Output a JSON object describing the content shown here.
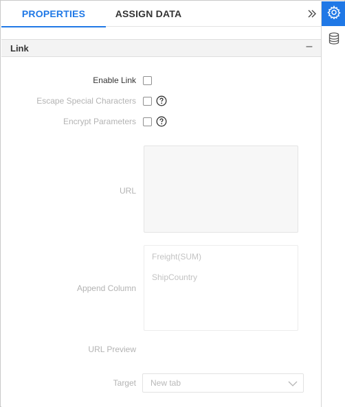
{
  "tabs": {
    "properties": "PROPERTIES",
    "assign_data": "ASSIGN DATA"
  },
  "icons": {
    "collapse": "double-chevron-right-icon",
    "settings": "gear-icon",
    "data": "database-icon",
    "help": "question-circle-icon",
    "dropdown": "chevron-down-icon"
  },
  "colors": {
    "accent": "#1f78e6"
  },
  "section": {
    "title": "Link",
    "toggle": "–"
  },
  "fields": {
    "enable_link": {
      "label": "Enable Link",
      "checked": false
    },
    "escape_special": {
      "label": "Escape Special Characters",
      "checked": false
    },
    "encrypt_params": {
      "label": "Encrypt Parameters",
      "checked": false
    },
    "url": {
      "label": "URL",
      "value": ""
    },
    "append_column": {
      "label": "Append Column",
      "items": [
        "Freight(SUM)",
        "ShipCountry"
      ]
    },
    "url_preview": {
      "label": "URL Preview",
      "value": ""
    },
    "target": {
      "label": "Target",
      "value": "New tab"
    }
  }
}
